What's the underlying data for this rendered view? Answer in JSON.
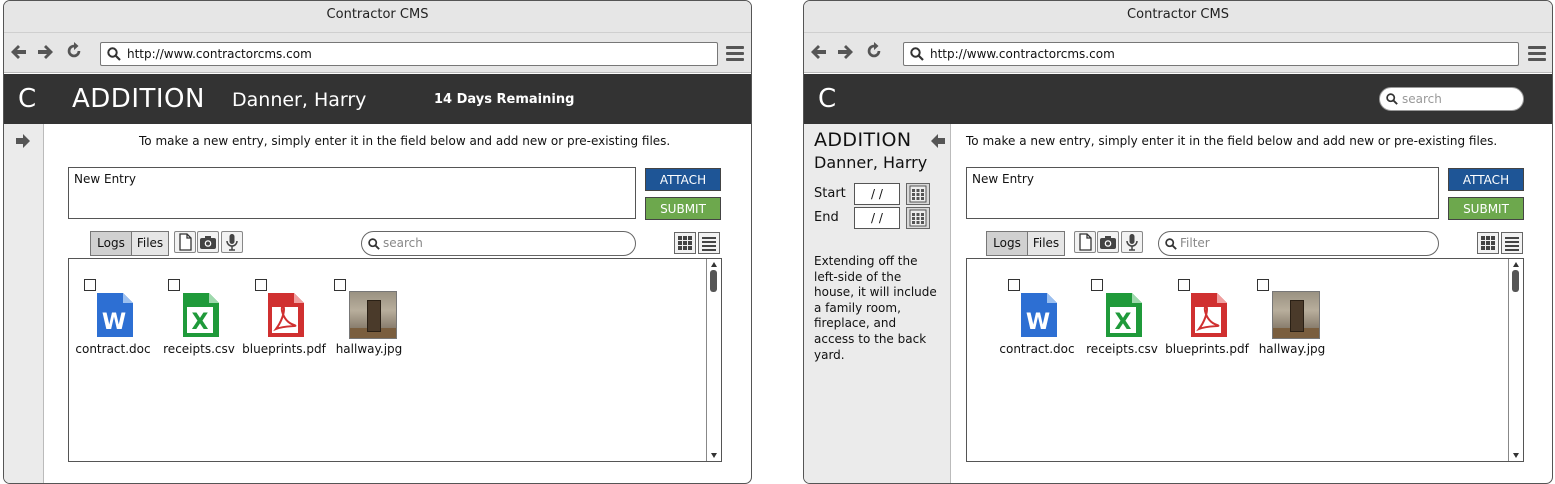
{
  "browser": {
    "title": "Contractor CMS",
    "url": "http://www.contractorcms.com"
  },
  "app": {
    "logo": "C",
    "project_title": "ADDITION",
    "project_name": "Danner, Harry",
    "days_remaining": "14 Days Remaining",
    "top_search_placeholder": "search"
  },
  "editor": {
    "instructions": "To make a new entry, simply enter it in the field below and add new or pre-existing files.",
    "entry_value": "New Entry",
    "attach_label": "ATTACH",
    "submit_label": "SUBMIT"
  },
  "tabs": [
    {
      "label": "Logs",
      "active": true
    },
    {
      "label": "Files",
      "active": false
    }
  ],
  "search": {
    "left_placeholder": "search",
    "right_placeholder": "Filter"
  },
  "files": [
    {
      "name": "contract.doc",
      "icon": "word-doc-icon",
      "color": "#2d6fd3",
      "letter": "W"
    },
    {
      "name": "receipts.csv",
      "icon": "excel-csv-icon",
      "color": "#1f9a3a",
      "letter": "X"
    },
    {
      "name": "blueprints.pdf",
      "icon": "pdf-icon",
      "color": "#d03030",
      "letter": "A"
    },
    {
      "name": "hallway.jpg",
      "icon": "image-thumbnail",
      "color": "#8a7d6a",
      "letter": ""
    }
  ],
  "sidebar_panel": {
    "title": "ADDITION",
    "name": "Danner, Harry",
    "start_label": "Start",
    "end_label": "End",
    "start_value": "/  /",
    "end_value": "/  /",
    "description": "Extending off the left-side of the house, it will include a family room, fireplace, and access to the back yard."
  }
}
